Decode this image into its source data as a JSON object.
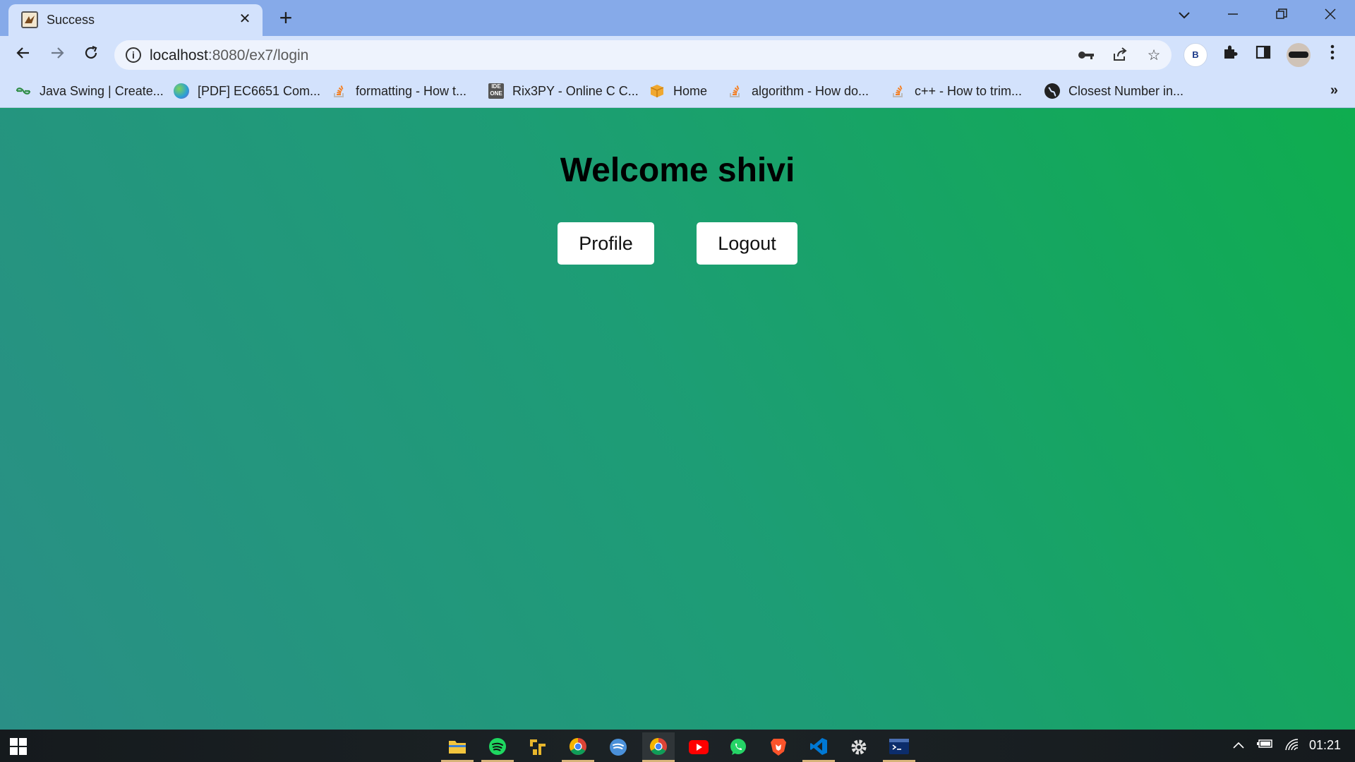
{
  "browser": {
    "tab_title": "Success",
    "tab_close": "✕",
    "new_tab": "+",
    "url_host": "localhost",
    "url_rest": ":8080/ex7/login",
    "extension_badge": "B"
  },
  "bookmarks": [
    {
      "label": "Java Swing | Create...",
      "icon": "geeksforgeeks-icon",
      "color": "#2f8d46"
    },
    {
      "label": "[PDF] EC6651 Com...",
      "icon": "globe-colorful-icon",
      "color": "#3aa0e0"
    },
    {
      "label": "formatting - How t...",
      "icon": "stackoverflow-icon",
      "color": "#f48024"
    },
    {
      "label": "Rix3PY - Online C C...",
      "icon": "ideone-icon",
      "color": "#555555"
    },
    {
      "label": "Home",
      "icon": "box-icon",
      "color": "#f0a830"
    },
    {
      "label": "algorithm - How do...",
      "icon": "stackoverflow-icon",
      "color": "#f48024"
    },
    {
      "label": "c++ - How to trim...",
      "icon": "stackoverflow-icon",
      "color": "#f48024"
    },
    {
      "label": "Closest Number in...",
      "icon": "globe-dark-icon",
      "color": "#222222"
    }
  ],
  "bookmarks_more": "»",
  "page": {
    "heading": "Welcome shivi",
    "profile_button": "Profile",
    "logout_button": "Logout"
  },
  "taskbar": {
    "apps": [
      {
        "name": "file-explorer",
        "color": "#f2c53d",
        "running": true
      },
      {
        "name": "spotify",
        "color": "#1ed760",
        "running": true
      },
      {
        "name": "pixel-app",
        "color": "#e8b62c",
        "running": false
      },
      {
        "name": "chrome",
        "color": "#db4437",
        "running": true
      },
      {
        "name": "spotify-web",
        "color": "#4a90d9",
        "running": false
      },
      {
        "name": "chrome-active",
        "color": "#db4437",
        "running": true,
        "active": true
      },
      {
        "name": "youtube",
        "color": "#ff0000",
        "running": false
      },
      {
        "name": "whatsapp",
        "color": "#25d366",
        "running": false
      },
      {
        "name": "brave",
        "color": "#fb542b",
        "running": false
      },
      {
        "name": "vscode",
        "color": "#0078d4",
        "running": true
      },
      {
        "name": "settings",
        "color": "#e0e0e0",
        "running": false
      },
      {
        "name": "terminal",
        "color": "#0c2d6b",
        "running": true
      }
    ],
    "clock": "01:21"
  }
}
